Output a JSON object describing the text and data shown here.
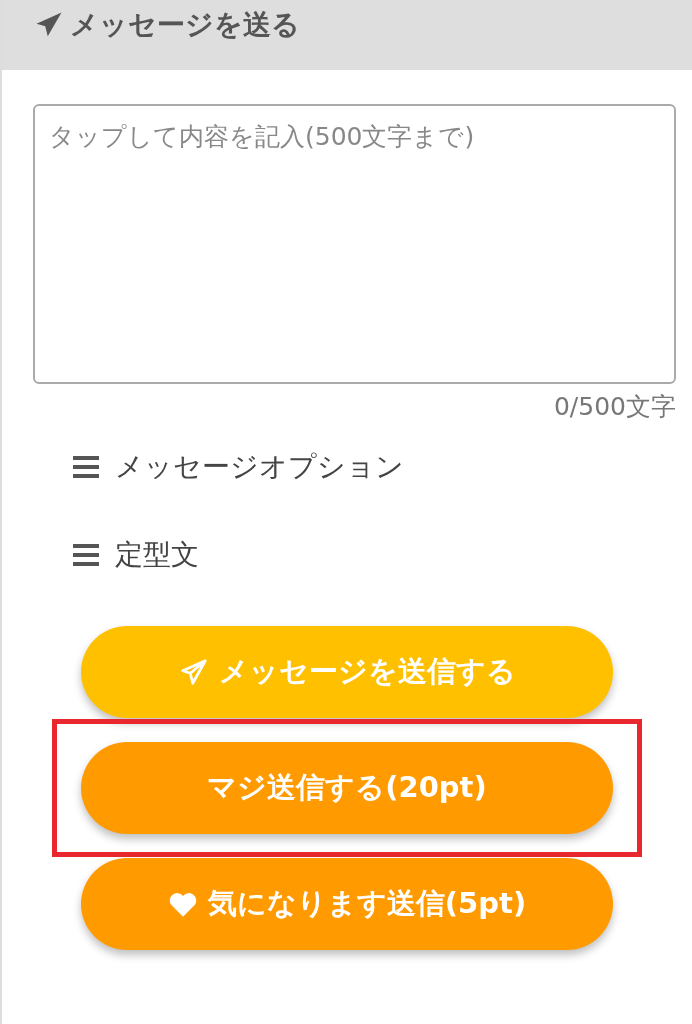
{
  "header": {
    "title": "メッセージを送る"
  },
  "message_field": {
    "placeholder": "タップして内容を記入(500文字まで)"
  },
  "counter": "0/500文字",
  "menu_items": [
    {
      "label": "メッセージオプション"
    },
    {
      "label": "定型文"
    }
  ],
  "buttons": [
    {
      "label": "メッセージを送信する",
      "kind": "plane",
      "color": "#ffc000",
      "highlighted": false
    },
    {
      "label": "マジ送信する(20pt)",
      "kind": "plain",
      "color": "#ff9a00",
      "highlighted": true
    },
    {
      "label": "気になります送信(5pt)",
      "kind": "heart",
      "color": "#ff9a00",
      "highlighted": false
    }
  ]
}
